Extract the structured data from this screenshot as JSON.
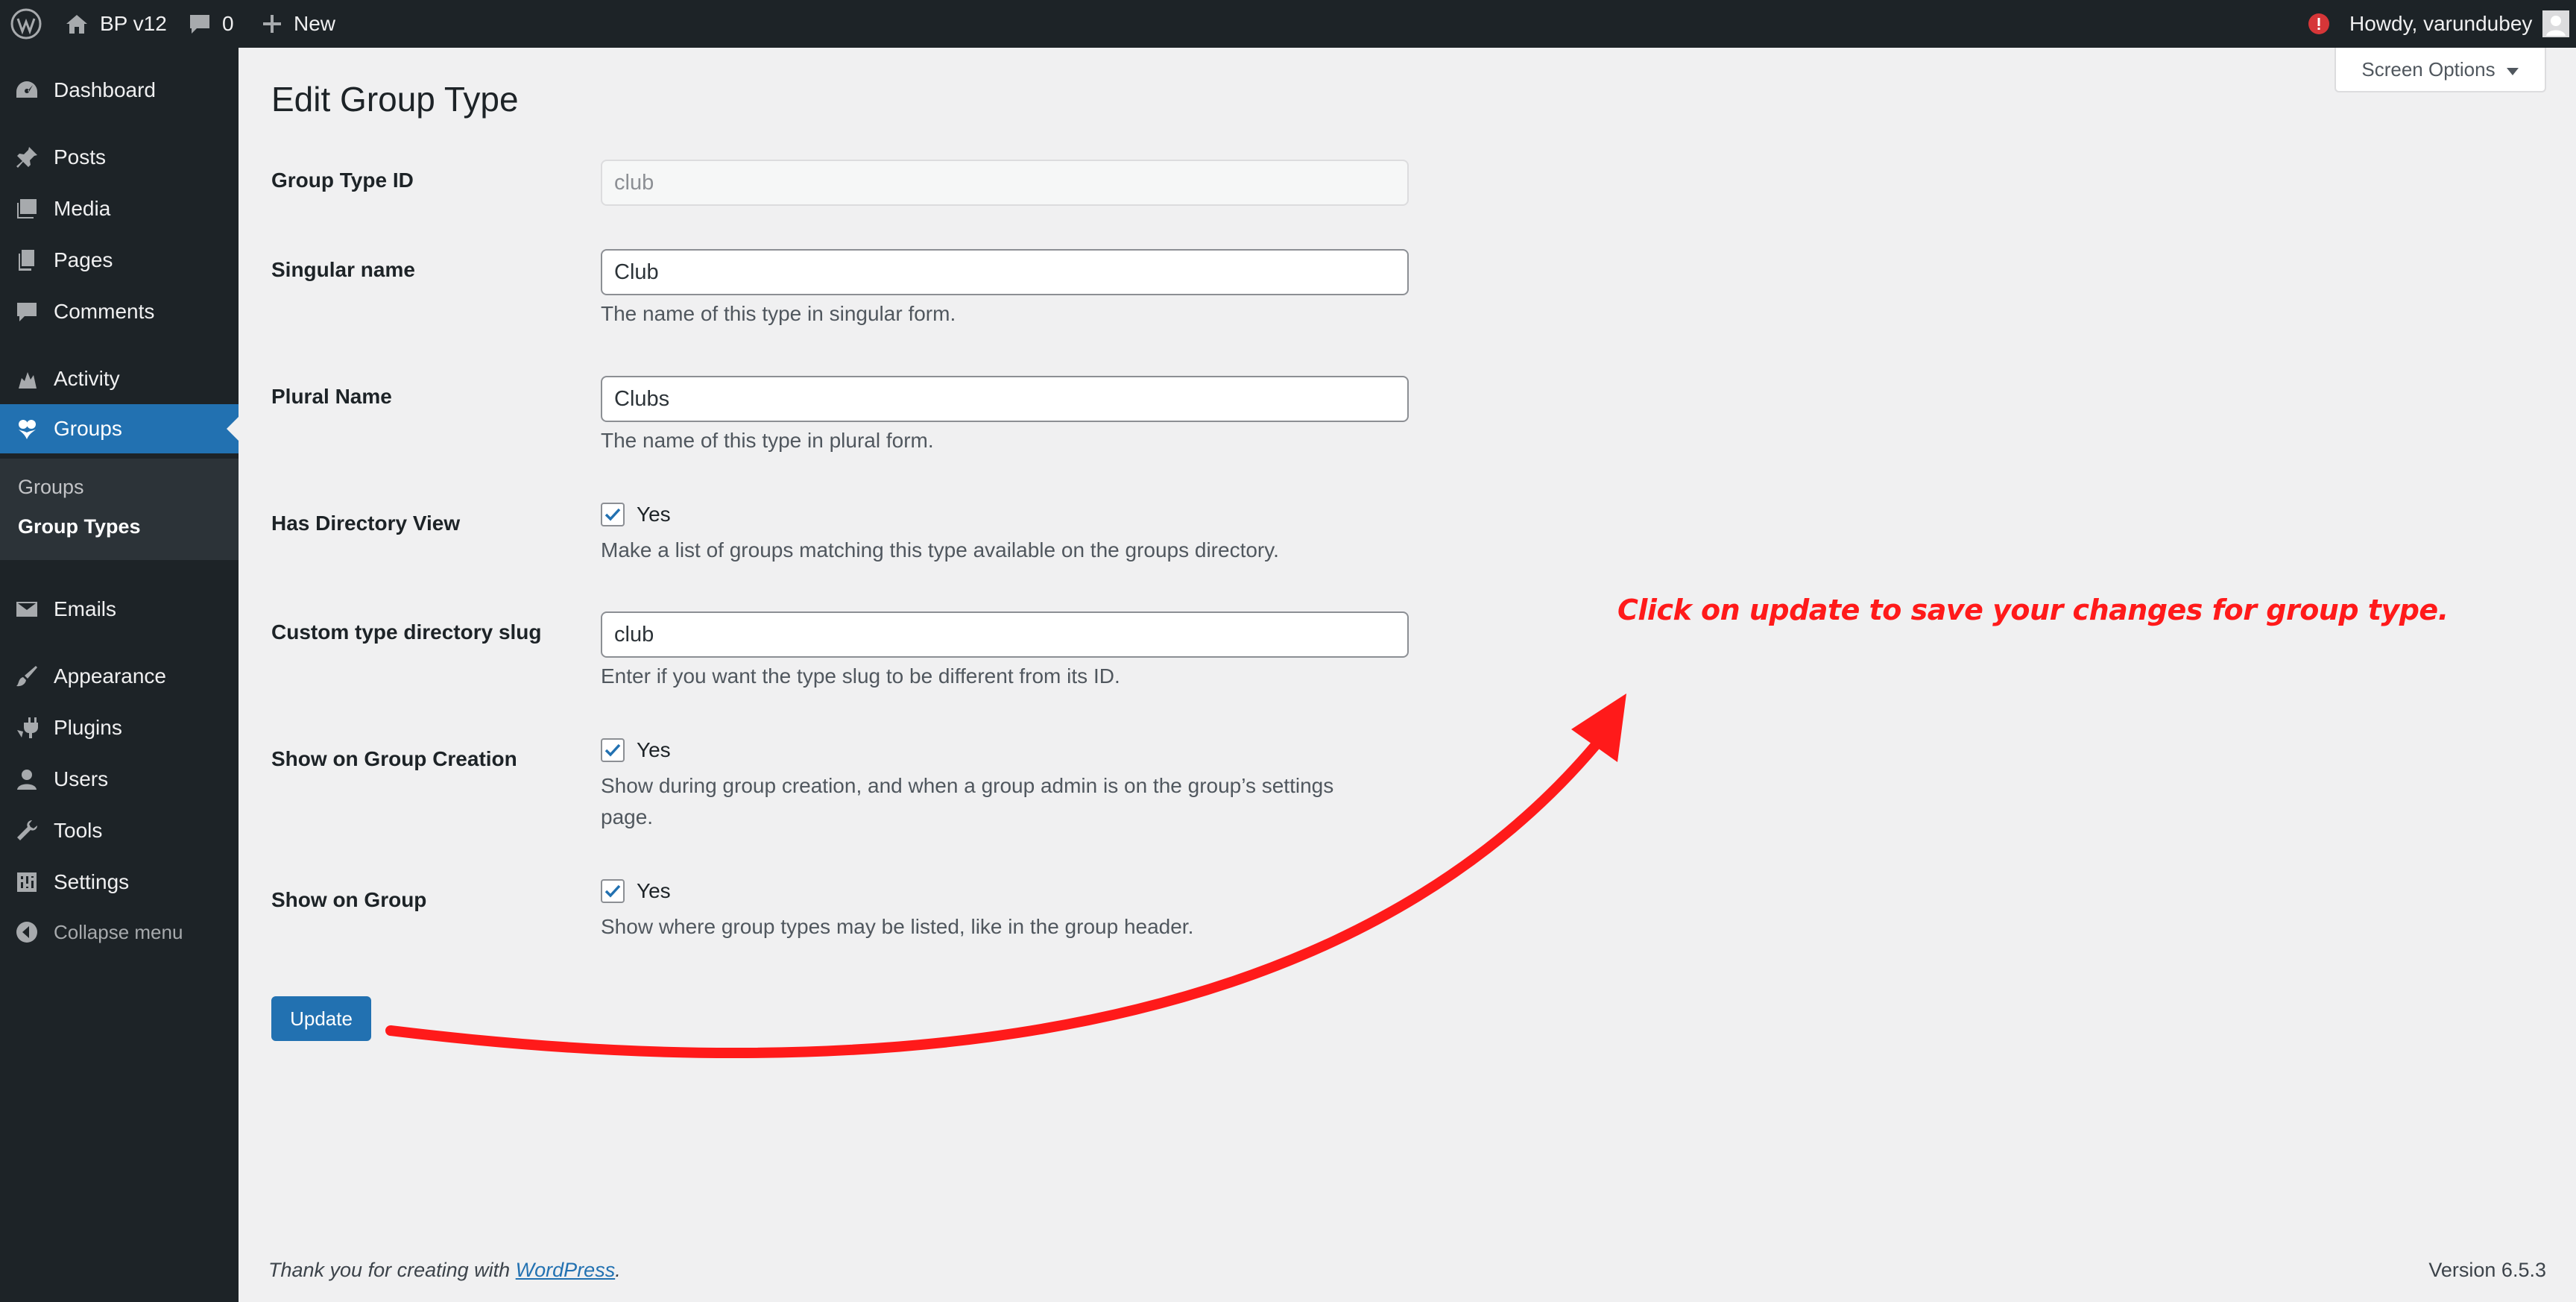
{
  "adminbar": {
    "site_name": "BP v12",
    "comments_count": "0",
    "new_label": "New",
    "greeting": "Howdy, varundubey"
  },
  "sidebar": {
    "items": [
      {
        "label": "Dashboard",
        "icon": "dashboard-icon"
      },
      {
        "label": "Posts",
        "icon": "pin-icon"
      },
      {
        "label": "Media",
        "icon": "media-icon"
      },
      {
        "label": "Pages",
        "icon": "pages-icon"
      },
      {
        "label": "Comments",
        "icon": "comment-icon"
      },
      {
        "label": "Activity",
        "icon": "activity-icon"
      },
      {
        "label": "Groups",
        "icon": "groups-icon"
      },
      {
        "label": "Emails",
        "icon": "email-icon"
      },
      {
        "label": "Appearance",
        "icon": "brush-icon"
      },
      {
        "label": "Plugins",
        "icon": "plug-icon"
      },
      {
        "label": "Users",
        "icon": "user-icon"
      },
      {
        "label": "Tools",
        "icon": "wrench-icon"
      },
      {
        "label": "Settings",
        "icon": "settings-icon"
      }
    ],
    "submenu": [
      "Groups",
      "Group Types"
    ],
    "collapse_label": "Collapse menu"
  },
  "screen_options_label": "Screen Options",
  "page_title": "Edit Group Type",
  "form": {
    "group_type_id": {
      "label": "Group Type ID",
      "value": "club"
    },
    "singular_name": {
      "label": "Singular name",
      "value": "Club",
      "description": "The name of this type in singular form."
    },
    "plural_name": {
      "label": "Plural Name",
      "value": "Clubs",
      "description": "The name of this type in plural form."
    },
    "has_directory": {
      "label": "Has Directory View",
      "checkbox_label": "Yes",
      "checked": true,
      "description": "Make a list of groups matching this type available on the groups directory."
    },
    "directory_slug": {
      "label": "Custom type directory slug",
      "value": "club",
      "description": "Enter if you want the type slug to be different from its ID."
    },
    "show_on_creation": {
      "label": "Show on Group Creation",
      "checkbox_label": "Yes",
      "checked": true,
      "description": "Show during group creation, and when a group admin is on the group’s settings page."
    },
    "show_on_group": {
      "label": "Show on Group",
      "checkbox_label": "Yes",
      "checked": true,
      "description": "Show where group types may be listed, like in the group header."
    }
  },
  "update_button": "Update",
  "annotation_text": "Click on update to save your changes for group type.",
  "footer": {
    "thanks_prefix": "Thank you for creating with ",
    "wordpress_link": "WordPress",
    "thanks_suffix": ".",
    "version": "Version 6.5.3"
  },
  "colors": {
    "admin_dark": "#1d2327",
    "accent": "#2271b1",
    "annotation_red": "#ff1a1a",
    "notification": "#d63638"
  }
}
